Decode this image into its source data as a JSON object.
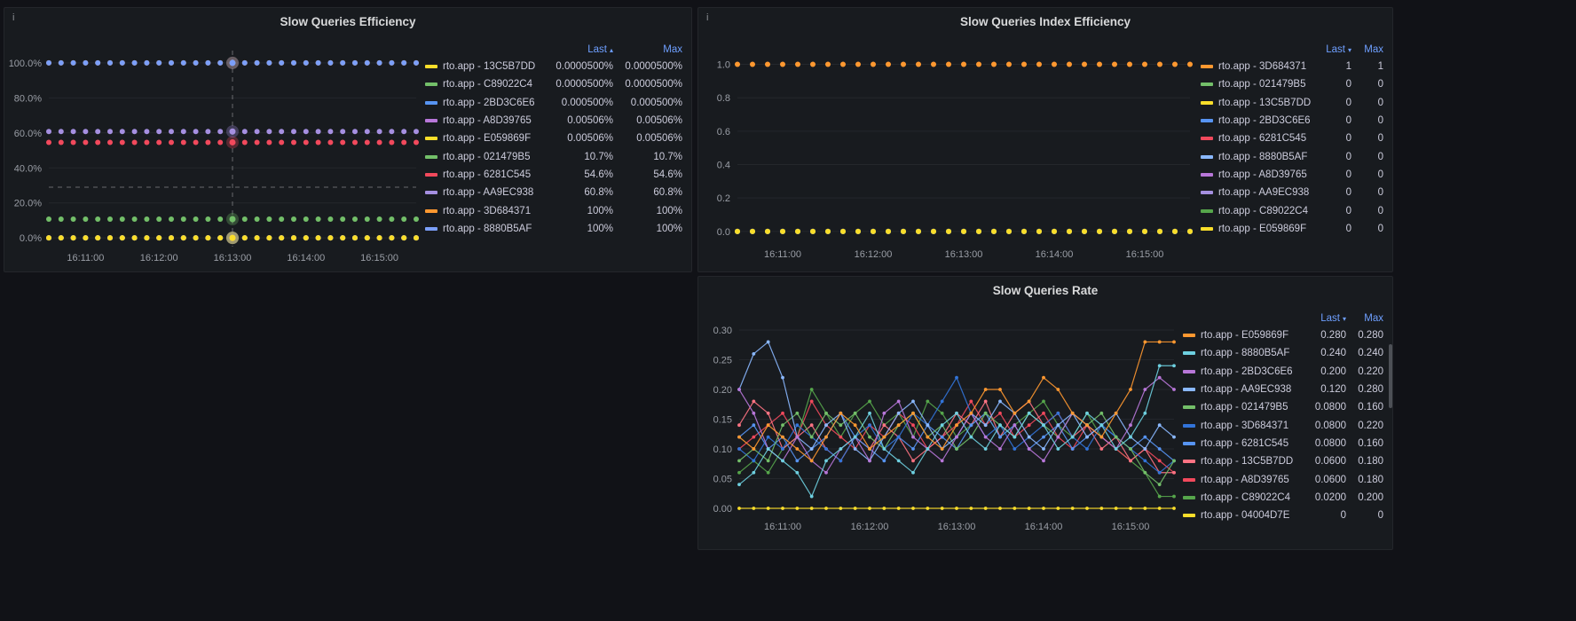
{
  "theme": {
    "background": "#111217",
    "panel_background": "#181b1f",
    "link_blue": "#6e9fff",
    "legend_text": "#ccccdc",
    "axis_text": "#9a9ea6"
  },
  "timeline": {
    "n_points": 31,
    "start": "16:10:30",
    "step_seconds": 10,
    "tick_indices": [
      3,
      9,
      15,
      21,
      27
    ],
    "tick_labels": [
      "16:11:00",
      "16:12:00",
      "16:13:00",
      "16:14:00",
      "16:15:00"
    ]
  },
  "panels": [
    {
      "title": "Slow Queries Efficiency",
      "info_icon": "i",
      "legend": {
        "last_label": "Last",
        "sort_caret": "▴",
        "max_label": "Max"
      },
      "chart_data": {
        "type": "scatter",
        "ylim": [
          -5,
          103
        ],
        "ytick_values": [
          0,
          20,
          40,
          60,
          80,
          100
        ],
        "ytick_labels": [
          "0.0%",
          "20.0%",
          "40.0%",
          "60.0%",
          "80.0%",
          "100.0%"
        ],
        "crosshair": {
          "x_index": 15,
          "y_value": 29,
          "time": "16:13:00"
        },
        "series": [
          {
            "name": "rto.app - 13C5B7DD",
            "color": "#FADE2A",
            "value": 5e-05,
            "last": "0.0000500%",
            "max": "0.0000500%"
          },
          {
            "name": "rto.app - C89022C4",
            "color": "#73BF69",
            "value": 5e-05,
            "last": "0.0000500%",
            "max": "0.0000500%"
          },
          {
            "name": "rto.app - 2BD3C6E6",
            "color": "#5794F2",
            "value": 0.0005,
            "last": "0.000500%",
            "max": "0.000500%"
          },
          {
            "name": "rto.app - A8D39765",
            "color": "#B877D9",
            "value": 0.00506,
            "last": "0.00506%",
            "max": "0.00506%"
          },
          {
            "name": "rto.app - E059869F",
            "color": "#FADE2A",
            "value": 0.00506,
            "last": "0.00506%",
            "max": "0.00506%"
          },
          {
            "name": "rto.app - 021479B5",
            "color": "#73BF69",
            "value": 10.7,
            "last": "10.7%",
            "max": "10.7%"
          },
          {
            "name": "rto.app - 6281C545",
            "color": "#F2495C",
            "value": 54.6,
            "last": "54.6%",
            "max": "54.6%"
          },
          {
            "name": "rto.app - AA9EC938",
            "color": "#A58FE0",
            "value": 60.8,
            "last": "60.8%",
            "max": "60.8%"
          },
          {
            "name": "rto.app - 3D684371",
            "color": "#FF9830",
            "value": 100,
            "last": "100%",
            "max": "100%"
          },
          {
            "name": "rto.app - 8880B5AF",
            "color": "#7B9FF9",
            "value": 100,
            "last": "100%",
            "max": "100%"
          }
        ]
      }
    },
    {
      "title": "Slow Queries Index Efficiency",
      "info_icon": "i",
      "legend": {
        "last_label": "Last",
        "sort_caret": "▾",
        "max_label": "Max"
      },
      "chart_data": {
        "type": "scatter",
        "ylim": [
          -0.07,
          1.04
        ],
        "ytick_values": [
          0,
          0.2,
          0.4,
          0.6,
          0.8,
          1.0
        ],
        "ytick_labels": [
          "0.0",
          "0.2",
          "0.4",
          "0.6",
          "0.8",
          "1.0"
        ],
        "series": [
          {
            "name": "rto.app - 3D684371",
            "color": "#FF9830",
            "value": 1,
            "last": "1",
            "max": "1"
          },
          {
            "name": "rto.app - 021479B5",
            "color": "#73BF69",
            "value": 0,
            "last": "0",
            "max": "0"
          },
          {
            "name": "rto.app - 13C5B7DD",
            "color": "#FADE2A",
            "value": 0,
            "last": "0",
            "max": "0"
          },
          {
            "name": "rto.app - 2BD3C6E6",
            "color": "#5794F2",
            "value": 0,
            "last": "0",
            "max": "0"
          },
          {
            "name": "rto.app - 6281C545",
            "color": "#F2495C",
            "value": 0,
            "last": "0",
            "max": "0"
          },
          {
            "name": "rto.app - 8880B5AF",
            "color": "#8AB8FF",
            "value": 0,
            "last": "0",
            "max": "0"
          },
          {
            "name": "rto.app - A8D39765",
            "color": "#B877D9",
            "value": 0,
            "last": "0",
            "max": "0"
          },
          {
            "name": "rto.app - AA9EC938",
            "color": "#A58FE0",
            "value": 0,
            "last": "0",
            "max": "0"
          },
          {
            "name": "rto.app - C89022C4",
            "color": "#56A64B",
            "value": 0,
            "last": "0",
            "max": "0"
          },
          {
            "name": "rto.app - E059869F",
            "color": "#FADE2A",
            "value": 0,
            "last": "0",
            "max": "0"
          }
        ]
      }
    },
    {
      "title": "Slow Queries Rate",
      "legend": {
        "last_label": "Last",
        "sort_caret": "▾",
        "max_label": "Max"
      },
      "chart_data": {
        "type": "line",
        "ylim": [
          -0.012,
          0.318
        ],
        "ytick_values": [
          0,
          0.05,
          0.1,
          0.15,
          0.2,
          0.25,
          0.3
        ],
        "ytick_labels": [
          "0.00",
          "0.05",
          "0.10",
          "0.15",
          "0.20",
          "0.25",
          "0.30"
        ],
        "series": [
          {
            "name": "rto.app - E059869F",
            "color": "#FF9830",
            "last": "0.280",
            "max": "0.280",
            "values": [
              0.12,
              0.1,
              0.14,
              0.12,
              0.1,
              0.08,
              0.12,
              0.16,
              0.14,
              0.1,
              0.12,
              0.14,
              0.16,
              0.12,
              0.1,
              0.14,
              0.16,
              0.2,
              0.2,
              0.16,
              0.18,
              0.22,
              0.2,
              0.16,
              0.14,
              0.12,
              0.16,
              0.2,
              0.28,
              0.28,
              0.28
            ]
          },
          {
            "name": "rto.app - 8880B5AF",
            "color": "#6ED0E0",
            "last": "0.240",
            "max": "0.240",
            "values": [
              0.04,
              0.06,
              0.1,
              0.08,
              0.06,
              0.02,
              0.08,
              0.1,
              0.12,
              0.16,
              0.1,
              0.08,
              0.06,
              0.1,
              0.14,
              0.16,
              0.12,
              0.1,
              0.14,
              0.12,
              0.16,
              0.14,
              0.1,
              0.12,
              0.16,
              0.14,
              0.1,
              0.12,
              0.16,
              0.24,
              0.24
            ]
          },
          {
            "name": "rto.app - 2BD3C6E6",
            "color": "#B877D9",
            "last": "0.200",
            "max": "0.220",
            "values": [
              0.2,
              0.16,
              0.1,
              0.08,
              0.12,
              0.08,
              0.06,
              0.1,
              0.12,
              0.08,
              0.16,
              0.18,
              0.12,
              0.1,
              0.08,
              0.12,
              0.16,
              0.12,
              0.1,
              0.14,
              0.1,
              0.08,
              0.12,
              0.16,
              0.14,
              0.12,
              0.1,
              0.14,
              0.2,
              0.22,
              0.2
            ]
          },
          {
            "name": "rto.app - AA9EC938",
            "color": "#8AB8FF",
            "last": "0.120",
            "max": "0.280",
            "values": [
              0.2,
              0.26,
              0.28,
              0.22,
              0.12,
              0.1,
              0.14,
              0.16,
              0.1,
              0.08,
              0.12,
              0.16,
              0.18,
              0.14,
              0.1,
              0.12,
              0.16,
              0.14,
              0.18,
              0.16,
              0.12,
              0.1,
              0.14,
              0.16,
              0.12,
              0.14,
              0.16,
              0.12,
              0.1,
              0.14,
              0.12
            ]
          },
          {
            "name": "rto.app - 021479B5",
            "color": "#73BF69",
            "last": "0.0800",
            "max": "0.160",
            "values": [
              0.08,
              0.1,
              0.08,
              0.14,
              0.16,
              0.12,
              0.16,
              0.14,
              0.16,
              0.12,
              0.1,
              0.14,
              0.16,
              0.12,
              0.14,
              0.1,
              0.12,
              0.16,
              0.14,
              0.12,
              0.16,
              0.14,
              0.12,
              0.16,
              0.14,
              0.16,
              0.12,
              0.1,
              0.06,
              0.04,
              0.08
            ]
          },
          {
            "name": "rto.app - 3D684371",
            "color": "#3274D9",
            "last": "0.0800",
            "max": "0.220",
            "values": [
              0.1,
              0.08,
              0.12,
              0.1,
              0.14,
              0.12,
              0.1,
              0.08,
              0.12,
              0.14,
              0.1,
              0.12,
              0.16,
              0.14,
              0.18,
              0.22,
              0.16,
              0.12,
              0.14,
              0.1,
              0.12,
              0.14,
              0.16,
              0.12,
              0.1,
              0.14,
              0.12,
              0.1,
              0.08,
              0.06,
              0.08
            ]
          },
          {
            "name": "rto.app - 6281C545",
            "color": "#5794F2",
            "last": "0.0800",
            "max": "0.160",
            "values": [
              0.12,
              0.14,
              0.1,
              0.12,
              0.08,
              0.1,
              0.12,
              0.16,
              0.12,
              0.1,
              0.08,
              0.12,
              0.1,
              0.14,
              0.12,
              0.1,
              0.14,
              0.16,
              0.12,
              0.14,
              0.1,
              0.12,
              0.14,
              0.1,
              0.12,
              0.14,
              0.12,
              0.1,
              0.12,
              0.1,
              0.08
            ]
          },
          {
            "name": "rto.app - 13C5B7DD",
            "color": "#FF7383",
            "last": "0.0600",
            "max": "0.180",
            "values": [
              0.14,
              0.18,
              0.16,
              0.1,
              0.12,
              0.14,
              0.1,
              0.08,
              0.12,
              0.1,
              0.14,
              0.12,
              0.08,
              0.1,
              0.12,
              0.16,
              0.14,
              0.18,
              0.12,
              0.16,
              0.18,
              0.14,
              0.16,
              0.12,
              0.14,
              0.1,
              0.12,
              0.08,
              0.1,
              0.06,
              0.06
            ]
          },
          {
            "name": "rto.app - A8D39765",
            "color": "#F2495C",
            "last": "0.0600",
            "max": "0.180",
            "values": [
              0.1,
              0.12,
              0.14,
              0.16,
              0.12,
              0.18,
              0.14,
              0.12,
              0.1,
              0.14,
              0.12,
              0.16,
              0.14,
              0.1,
              0.12,
              0.14,
              0.18,
              0.14,
              0.16,
              0.12,
              0.14,
              0.16,
              0.12,
              0.1,
              0.14,
              0.12,
              0.1,
              0.08,
              0.1,
              0.08,
              0.06
            ]
          },
          {
            "name": "rto.app - C89022C4",
            "color": "#56A64B",
            "last": "0.0200",
            "max": "0.200",
            "values": [
              0.06,
              0.08,
              0.06,
              0.1,
              0.12,
              0.2,
              0.16,
              0.12,
              0.16,
              0.18,
              0.14,
              0.16,
              0.12,
              0.18,
              0.16,
              0.12,
              0.14,
              0.16,
              0.12,
              0.14,
              0.16,
              0.18,
              0.14,
              0.12,
              0.16,
              0.12,
              0.1,
              0.08,
              0.06,
              0.02,
              0.02
            ]
          },
          {
            "name": "rto.app - 04004D7E",
            "color": "#FADE2A",
            "last": "0",
            "max": "0",
            "values": [
              0,
              0,
              0,
              0,
              0,
              0,
              0,
              0,
              0,
              0,
              0,
              0,
              0,
              0,
              0,
              0,
              0,
              0,
              0,
              0,
              0,
              0,
              0,
              0,
              0,
              0,
              0,
              0,
              0,
              0,
              0
            ]
          }
        ]
      }
    }
  ]
}
